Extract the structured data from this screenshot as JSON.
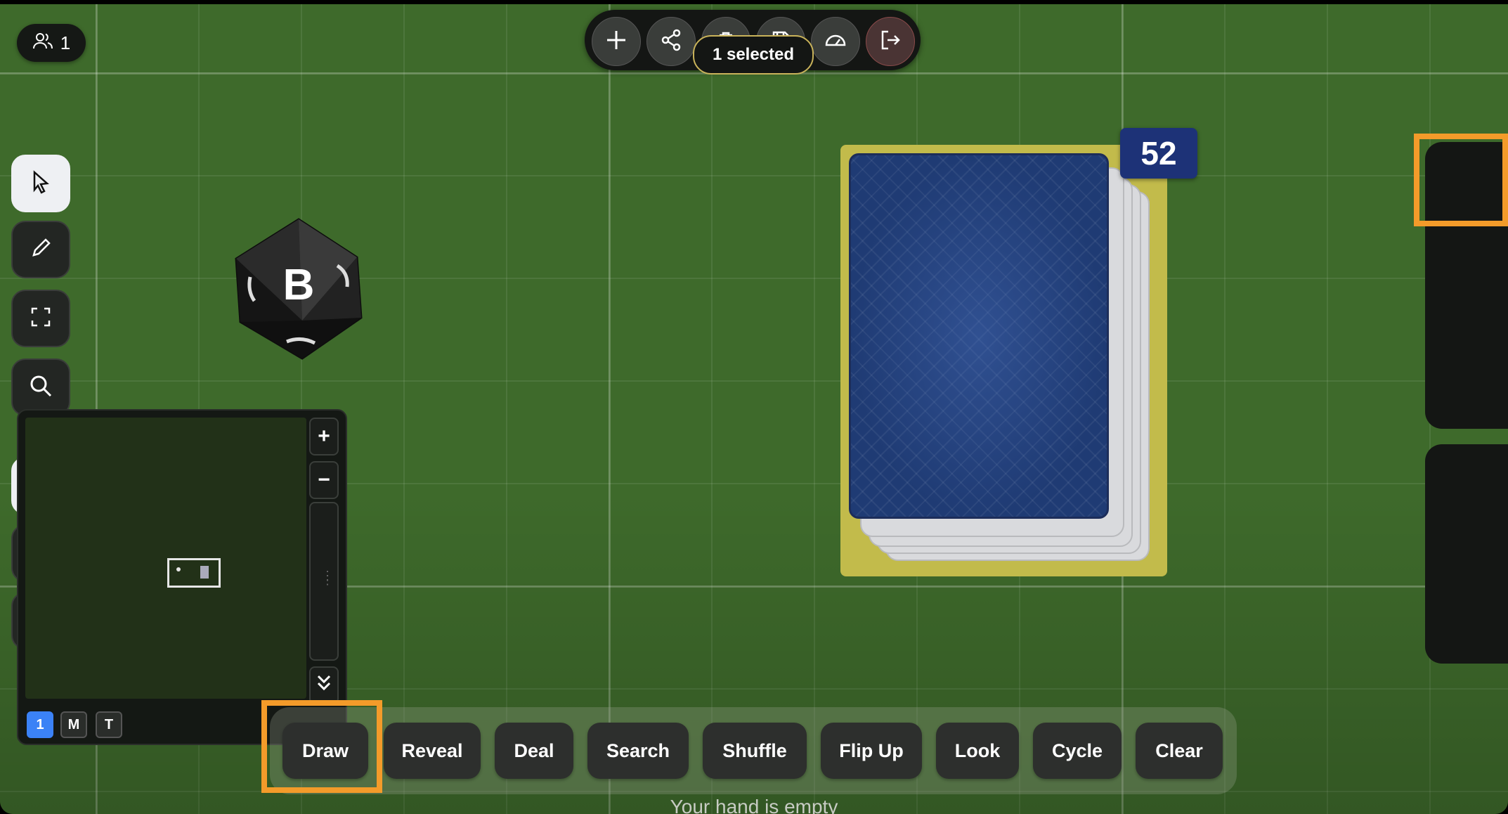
{
  "players": {
    "count": "1",
    "icon": "users-icon"
  },
  "toolbar": {
    "buttons": [
      {
        "name": "add",
        "icon": "plus-icon"
      },
      {
        "name": "share",
        "icon": "share-icon"
      },
      {
        "name": "trash",
        "icon": "trash-icon"
      },
      {
        "name": "save",
        "icon": "save-icon"
      },
      {
        "name": "performance",
        "icon": "gauge-icon"
      },
      {
        "name": "exit",
        "icon": "logout-icon"
      }
    ],
    "selection_label": "1 selected"
  },
  "die": {
    "face": "B"
  },
  "deck": {
    "count": "52"
  },
  "side_tools": {
    "top": [
      {
        "name": "select",
        "icon": "cursor-icon",
        "active": true
      },
      {
        "name": "draw",
        "icon": "pencil-icon"
      },
      {
        "name": "fullscreen",
        "icon": "expand-icon"
      },
      {
        "name": "search",
        "icon": "search-icon"
      }
    ],
    "bottom": [
      {
        "name": "notes",
        "icon": "document-icon",
        "active": true
      },
      {
        "name": "grid",
        "icon": "grid-icon"
      },
      {
        "name": "text",
        "icon": "triangle-icon"
      }
    ]
  },
  "minimap": {
    "zoom_in": "+",
    "zoom_out": "−",
    "tabs": [
      "1",
      "M",
      "T"
    ],
    "active_tab": "1"
  },
  "actions": {
    "buttons": [
      "Draw",
      "Reveal",
      "Deal",
      "Search",
      "Shuffle",
      "Flip Up",
      "Look",
      "Cycle",
      "Clear"
    ],
    "highlighted": "Draw"
  },
  "hand_status": "Your hand is empty",
  "colors": {
    "table": "#3e6a2b",
    "highlight": "#f39b2a",
    "deck_base": "#c2bb4b",
    "badge": "#1d3277",
    "active_tab": "#3b82f6"
  }
}
